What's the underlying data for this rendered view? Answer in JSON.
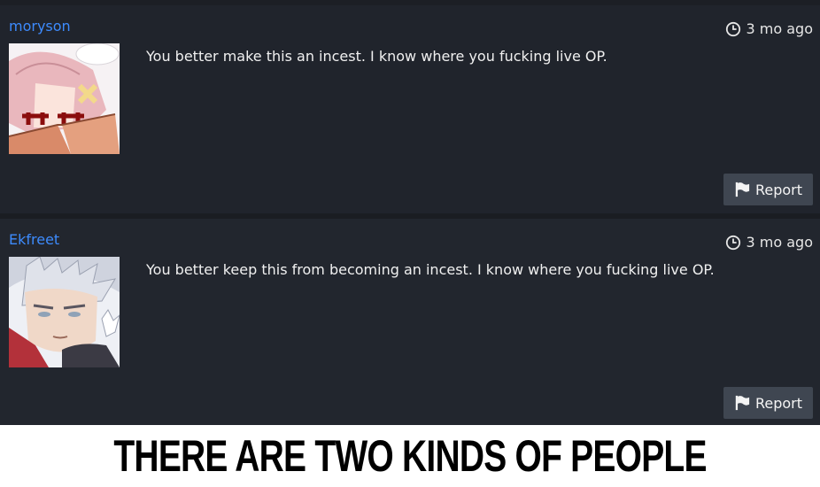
{
  "comments": [
    {
      "username": "moryson",
      "time": "3 mo ago",
      "text": "You better make this an incest. I know where you fucking live OP.",
      "report_label": "Report"
    },
    {
      "username": "Ekfreet",
      "time": "3 mo ago",
      "text": "You better keep this from becoming an incest. I know where you fucking live OP.",
      "report_label": "Report"
    }
  ],
  "caption": "THERE ARE TWO KINDS OF PEOPLE",
  "colors": {
    "background": "#22262e",
    "username": "#3d8bfd",
    "report_button": "#3f4651"
  },
  "icons": [
    "clock-icon",
    "flag-icon"
  ]
}
